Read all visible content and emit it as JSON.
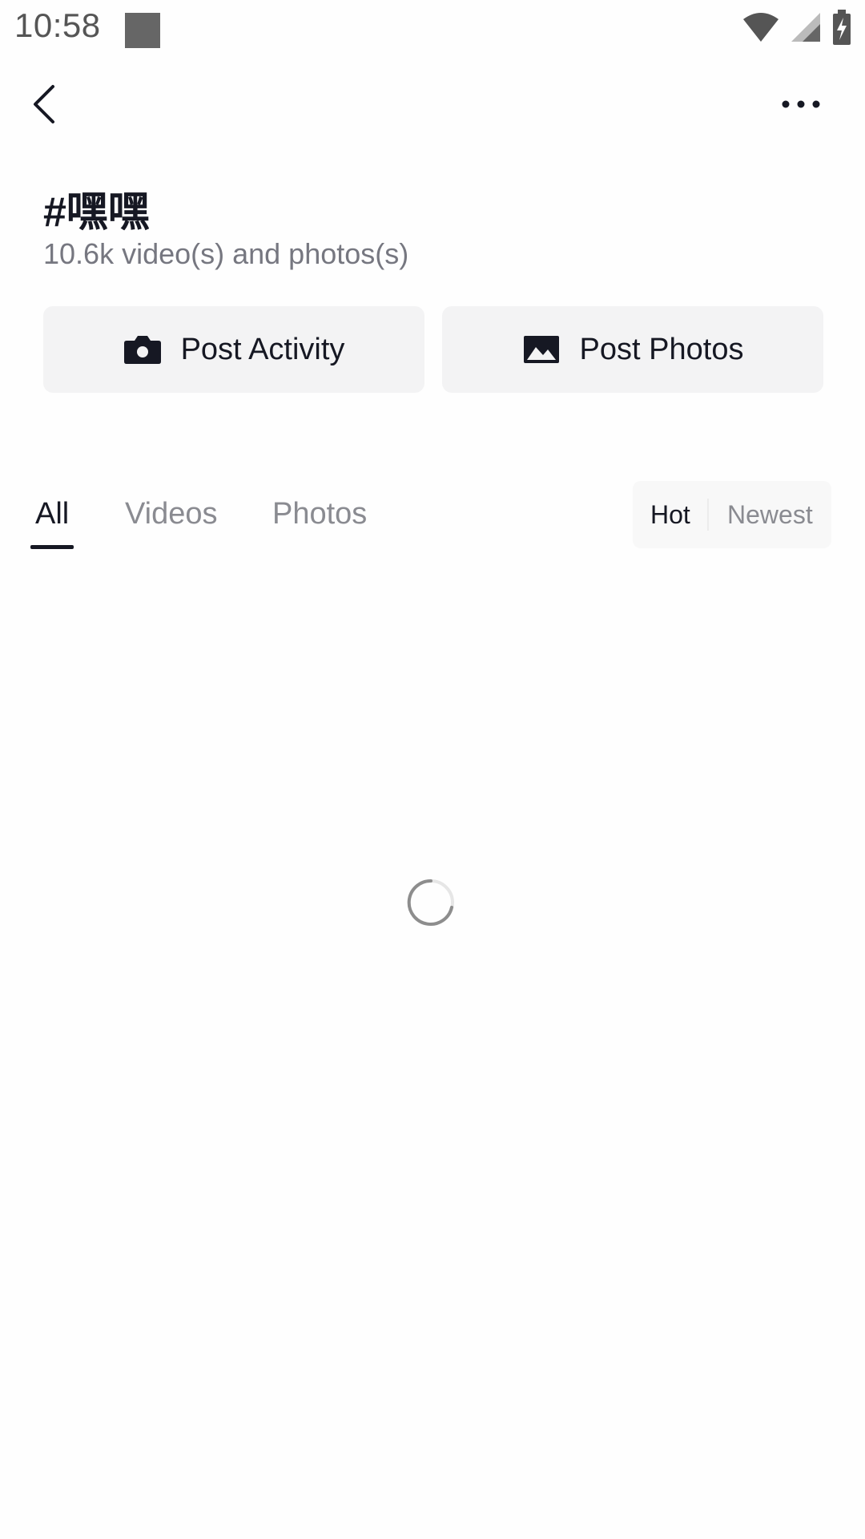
{
  "status_bar": {
    "time": "10:58"
  },
  "header": {
    "hashtag_title": "#嘿嘿",
    "count_text": "10.6k video(s) and photos(s)"
  },
  "actions": {
    "post_activity_label": "Post Activity",
    "post_photos_label": "Post Photos"
  },
  "tabs": [
    {
      "label": "All",
      "active": true
    },
    {
      "label": "Videos",
      "active": false
    },
    {
      "label": "Photos",
      "active": false
    }
  ],
  "sort": {
    "hot_label": "Hot",
    "newest_label": "Newest",
    "selected": "Hot"
  },
  "icons": {
    "back": "chevron-left-icon",
    "more": "more-horizontal-icon",
    "camera": "camera-icon",
    "image": "image-icon",
    "wifi": "wifi-icon",
    "signal": "signal-icon",
    "battery": "battery-charging-icon",
    "loading": "loading-spinner-icon"
  },
  "colors": {
    "primary_text": "#161823",
    "secondary_text": "#8a8b91",
    "button_bg": "#f3f3f4"
  }
}
